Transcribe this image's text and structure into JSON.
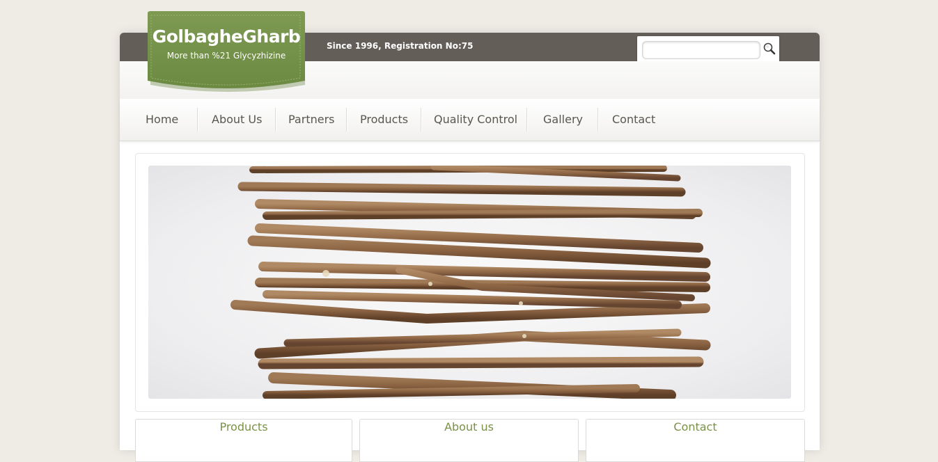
{
  "logo": {
    "title": "GolbagheGharb",
    "subtitle": "More than  %21 Glycyzhizine"
  },
  "header": {
    "tagline": "Since 1996, Registration No:75"
  },
  "search": {
    "value": "",
    "placeholder": ""
  },
  "nav": {
    "items": [
      {
        "label": "Home"
      },
      {
        "label": "About Us"
      },
      {
        "label": "Partners"
      },
      {
        "label": "Products"
      },
      {
        "label": "Quality Control"
      },
      {
        "label": "Gallery"
      },
      {
        "label": "Contact"
      }
    ]
  },
  "boxes": [
    {
      "title": "Products"
    },
    {
      "title": "About us"
    },
    {
      "title": "Contact"
    }
  ],
  "colors": {
    "background": "#efebe5",
    "topbar": "#645e58",
    "logo_green": "#74914a",
    "box_title_green": "#7b9147",
    "nav_text": "#5a5650"
  },
  "icons": {
    "search": "magnifier-icon"
  }
}
